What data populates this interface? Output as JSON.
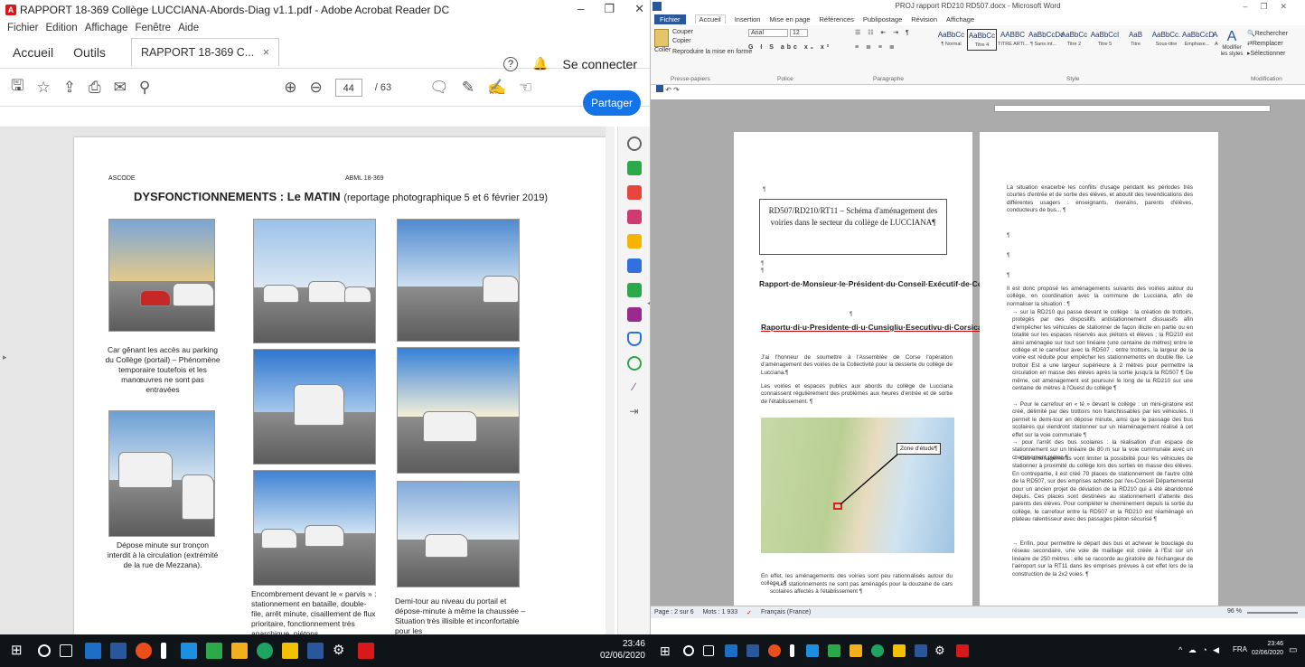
{
  "acrobat": {
    "title": "RAPPORT 18-369 Collège LUCCIANA-Abords-Diag v1.1.pdf - Adobe Acrobat Reader DC",
    "menu": [
      "Fichier",
      "Edition",
      "Affichage",
      "Fenêtre",
      "Aide"
    ],
    "tabs": {
      "home": "Accueil",
      "tools": "Outils",
      "doc": "RAPPORT 18-369 C...",
      "close": "×"
    },
    "sign_in": "Se connecter",
    "page_current": "44",
    "page_total": "/ 63",
    "share": "Partager",
    "page": {
      "header_left": "ASCODE",
      "header_right": "ABML 18-369",
      "heading_bold": "DYSFONCTIONNEMENTS : Le MATIN",
      "heading_rest": "(reportage photographique 5 et 6 février 2019)",
      "caption1": "Car gênant les accès au parking du Collège (portail) – Phénomène temporaire toutefois et les manœuvres ne sont pas entravées",
      "caption2": "Dépose minute sur tronçon interdit à la circulation (extrémité de la rue de Mezzana).",
      "caption3": "Encombrement devant le « parvis » : stationnement en bataille, double-file, arrêt minute, cisaillement de flux prioritaire, fonctionnement très anarchique, piétons",
      "caption4": "Demi-tour au niveau du portail et dépose-minute à même la chaussée – Situation très illisible et inconfortable pour les"
    }
  },
  "word": {
    "title": "PROJ rapport RD210 RD507.docx - Microsoft Word",
    "tabs": [
      "Fichier",
      "Accueil",
      "Insertion",
      "Mise en page",
      "Références",
      "Publipostage",
      "Révision",
      "Affichage"
    ],
    "clipboard": {
      "paste": "Coller",
      "cut": "Couper",
      "copy": "Copier",
      "format": "Reproduire la mise en forme",
      "label": "Presse-papiers"
    },
    "font": {
      "name": "Arial",
      "size": "12",
      "label": "Police"
    },
    "paragraph_label": "Paragraphe",
    "styles": [
      {
        "preview": "AaBbCc",
        "name": "¶ Normal"
      },
      {
        "preview": "AaBbCc",
        "name": "Titre 4"
      },
      {
        "preview": "AABBC",
        "name": "TITRE ARTI..."
      },
      {
        "preview": "AaBbCcDc",
        "name": "¶ Sans int..."
      },
      {
        "preview": "AaBbCc",
        "name": "Titre 2"
      },
      {
        "preview": "AaBbCcI",
        "name": "Titre 5"
      },
      {
        "preview": "AaB",
        "name": "Titre"
      },
      {
        "preview": "AaBbCc.",
        "name": "Sous-titre"
      },
      {
        "preview": "AaBbCcD",
        "name": "Emphase..."
      },
      {
        "preview": "AaBbCcD",
        "name": "Accentuat..."
      },
      {
        "preview": "AaBbCcD",
        "name": "Emphase i..."
      },
      {
        "preview": "AaBbCcI",
        "name": "Élevé"
      },
      {
        "preview": "AaBbCcI",
        "name": "Citation"
      }
    ],
    "styles_label": "Style",
    "change_styles": "Modifier les styles",
    "editing": {
      "find": "Rechercher",
      "replace": "Remplacer",
      "select": "Sélectionner",
      "label": "Modification"
    },
    "left_page": {
      "box_title": "RD507/RD210/RT11 – Schéma d'aménagement des voiries dans le secteur du collège de LUCCIANA¶",
      "h1": "Rapport·de·Monsieur·le·Président·du·Conseil·Exécutif·de·Corse¶",
      "h2": "Raportu·di·u·Presidente·di·u·Cunsigliu·Esecutivu·di·Corsica¶",
      "p1": "J'ai l'honneur de soumettre à l'Assemblée de Corse l'opération d'aménagement des voiries de la Collectivité pour la desserte du collège de Lucciana.¶",
      "p2": "Les voiries et espaces publics aux abords du collège de Lucciana connaissent régulièrement des problèmes aux heures d'entrée et de sortie de l'établissement. ¶",
      "map_label": "Zone d'étude¶",
      "p3": "En effet, les aménagements des voiries sont peu rationnalisés autour du collège : ¶",
      "p4": "→ Les stationnements ne sont pas aménagés pour la douzaine de cars scolaires affectés à l'établissement ¶"
    },
    "right_page": {
      "p1": "La situation exacerbe les conflits d'usage pendant les périodes très courtes d'entrée et de sortie des élèves, et aboutit des revendications des différentes usagers : enseignants, riverains, parents d'élèves, conducteurs de bus... ¶",
      "p2": "Il est donc proposé les aménagements suivants des voiries autour du collège, en coordination avec la commune de Lucciana, afin de normaliser la situation : ¶",
      "b1": "→ sur la RD210 qui passe devant le collège : la création de trottoirs, protégés par des dispositifs antistationnement dissuasifs afin d'empêcher les véhicules de stationner de façon illicite en partie ou en totalité sur les espaces réservés aux piétons et élèves ; la RD210 est ainsi aménagée sur tout son linéaire (une centaine de mètres) entre le collège et le carrefour avec la RD507 ; entre trottoirs, la largeur de la voirie est réduite pour empêcher les stationnements en double file. Le trottoir Est a une largeur supérieure à 2 mètres pour permettre la circulation en masse des élèves après la sortie jusqu'à la RD507 ¶ De même, cet aménagement est poursuivi le long de la RD210 sur une centaine de mètres à l'Ouest du collège ¶",
      "b2": "→ Pour le carrefour en « té » devant le collège : un mini-giratoire est créé, délimité par des trottoirs non franchissables par les véhicules. Il permet le demi-tour en dépose minute, ainsi que le passage des bus scolaires qui viendront stationner sur un réaménagement réalisé à cet effet sur la voie communale ¶",
      "b3": "→ pour l'arrêt des bus scolaires : la réalisation d'un espace de stationnement sur un linéaire de 80 m sur la voie communale avec un cheminement piéton ¶",
      "b4": "→ Ces aménagements vont limiter la possibilité pour les véhicules de stationner à proximité du collège lors des sorties en masse des élèves. En contrepartie, il est créé 70 places de stationnement de l'autre côté de la RD507, sur des emprises achetés par l'ex-Conseil Départemental pour un ancien projet de déviation de la RD210 qui a été abandonné depuis. Ces places sont destinées au stationnement d'attente des parents des élèves. Pour compléter le cheminement depuis la sortie du collège, le carrefour entre la RD507 et la RD210 est réaménagé en plateau ralentisseur avec des passages piéton sécurisé ¶",
      "b5": "→ Enfin, pour permettre le départ des bus et achever le bouclage du réseau secondaire, une voie de maillage est créée à l'Est sur un linéaire de 250 mètres : elle se raccorde au giratoire de l'échangeur de l'aéroport sur la RT11 dans les emprises prévues à cet effet lors de la construction de la 2x2 voies. ¶"
    },
    "status": {
      "page": "Page : 2 sur 6",
      "words": "Mots : 1 933",
      "lang": "Français (France)",
      "zoom": "96 %"
    }
  },
  "taskbar": {
    "time_left": "23:46",
    "date_left": "02/06/2020",
    "lang": "FRA",
    "time_right": "23:46",
    "date_right": "02/06/2020"
  },
  "colors": {
    "acrobat_red": "#d7191c",
    "share_blue": "#1473e6",
    "word_blue": "#2a579a",
    "taskbar": "#0f1418"
  }
}
